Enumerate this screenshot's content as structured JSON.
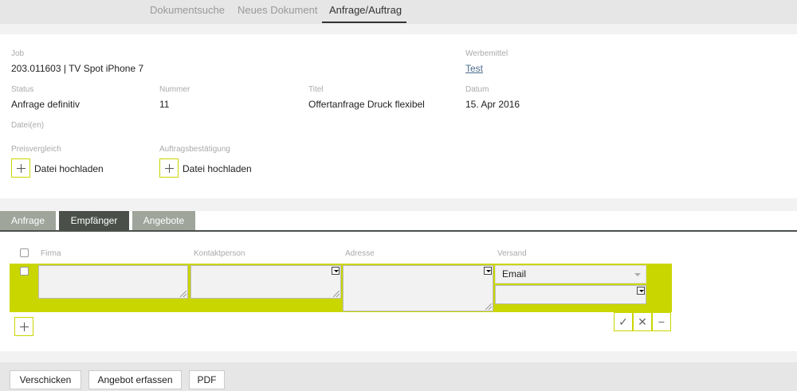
{
  "topnav": {
    "tabs": [
      {
        "label": "Dokumentsuche"
      },
      {
        "label": "Neues Dokument"
      },
      {
        "label": "Anfrage/Auftrag"
      }
    ],
    "active_index": 2
  },
  "details": {
    "job": {
      "label": "Job",
      "value": "203.011603 | TV Spot iPhone 7"
    },
    "werbemittel": {
      "label": "Werbemittel",
      "value": "Test"
    },
    "status": {
      "label": "Status",
      "value": "Anfrage definitiv"
    },
    "nummer": {
      "label": "Nummer",
      "value": "11"
    },
    "titel": {
      "label": "Titel",
      "value": "Offertanfrage Druck flexibel"
    },
    "datum": {
      "label": "Datum",
      "value": "15. Apr 2016"
    },
    "dateien": {
      "label": "Datei(en)"
    },
    "preisvergleich": {
      "label": "Preisvergleich",
      "upload_label": "Datei hochladen"
    },
    "auftragsbestaetigung": {
      "label": "Auftragsbestätigung",
      "upload_label": "Datei hochladen"
    }
  },
  "subtabs": [
    {
      "label": "Anfrage"
    },
    {
      "label": "Empfänger"
    },
    {
      "label": "Angebote"
    }
  ],
  "subtab_active_index": 1,
  "table": {
    "columns": [
      "Firma",
      "Kontaktperson",
      "Adresse",
      "Versand"
    ],
    "row": {
      "firma": "",
      "kontaktperson": "",
      "adresse": "",
      "versand": "Email"
    },
    "actions": {
      "confirm": "✓",
      "cancel": "✕",
      "remove": "−"
    }
  },
  "footer": {
    "buttons": [
      {
        "label": "Verschicken"
      },
      {
        "label": "Angebot erfassen"
      },
      {
        "label": "PDF"
      }
    ]
  },
  "colors": {
    "accent": "#c9d600",
    "tab_active": "#4a4f4a",
    "tab_inactive": "#9fa59b",
    "link": "#4a6c8c"
  }
}
